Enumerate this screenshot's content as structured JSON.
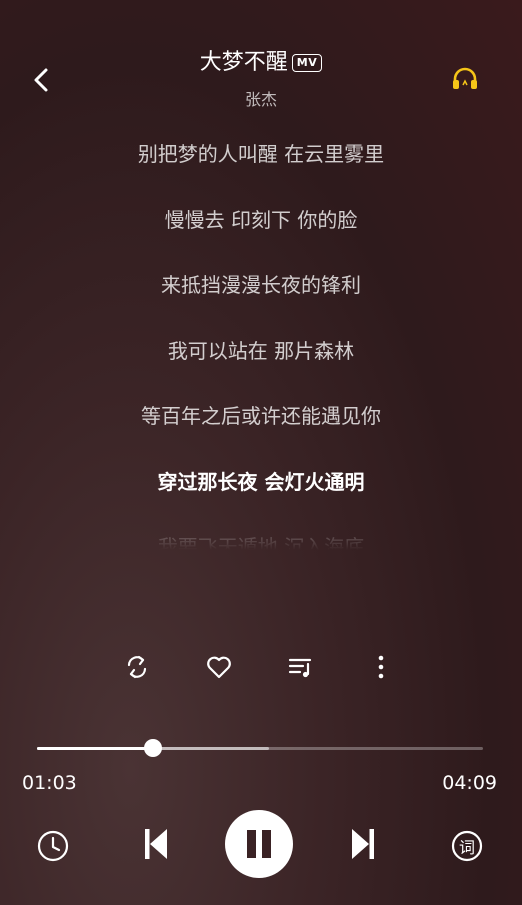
{
  "header": {
    "title": "大梦不醒",
    "mv_badge": "MV",
    "artist": "张杰",
    "back_icon": "chevron-left-icon",
    "headset_icon": "headphones-icon",
    "headset_color": "#f5c518"
  },
  "lyrics": [
    "别把梦的人叫醒 在云里雾里",
    "慢慢去 印刻下 你的脸",
    "来抵挡漫漫长夜的锋利",
    "我可以站在 那片森林",
    "等百年之后或许还能遇见你",
    "穿过那长夜 会灯火通明",
    "我要飞天遁地 沉入海底"
  ],
  "active_lyric_index": 5,
  "actions": {
    "repeat_icon": "repeat-icon",
    "like_icon": "heart-icon",
    "playlist_icon": "playlist-icon",
    "more_icon": "more-vertical-icon"
  },
  "playback": {
    "current_time": "01:03",
    "total_time": "04:09",
    "progress_fraction": 0.26,
    "buffered_fraction": 0.52
  },
  "controls": {
    "timer_icon": "clock-icon",
    "prev_icon": "skip-previous-icon",
    "play_pause_icon": "pause-icon",
    "next_icon": "skip-next-icon",
    "lyrics_label": "词"
  }
}
